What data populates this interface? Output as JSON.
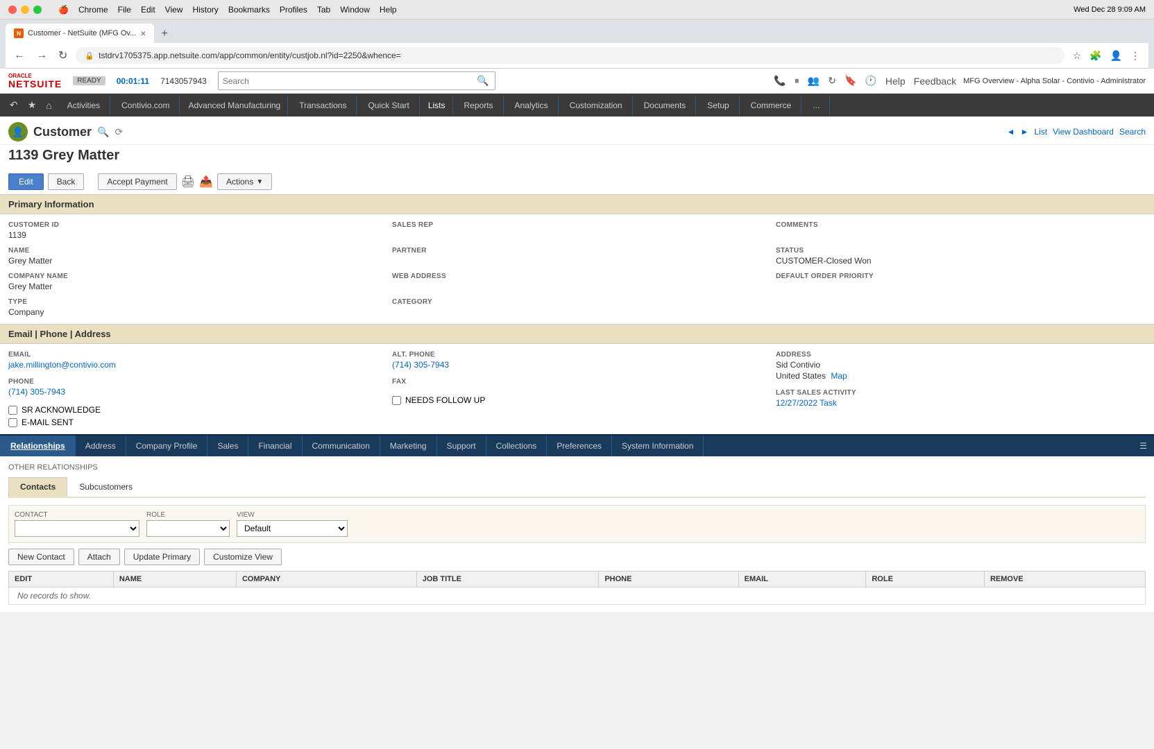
{
  "macbar": {
    "menus": [
      "Chrome",
      "File",
      "Edit",
      "View",
      "History",
      "Bookmarks",
      "Profiles",
      "Tab",
      "Window",
      "Help"
    ],
    "datetime": "Wed Dec 28  9:09 AM"
  },
  "browser": {
    "tab_title": "Customer - NetSuite (MFG Ov...",
    "address": "tstdrv1705375.app.netsuite.com/app/common/entity/custjob.nl?id=2250&whence=",
    "new_tab_label": "+"
  },
  "ns_header": {
    "logo": "ORACLE NETSUITE",
    "ready_label": "READY",
    "timer": "00:01:11",
    "phone": "7143057943",
    "help_label": "Help",
    "feedback_label": "Feedback",
    "account": "MFG Overview - Alpha Solar - Contivio - Administrator"
  },
  "ns_nav": {
    "home_icon": "⌂",
    "star_icon": "★",
    "back_icon": "↶",
    "items": [
      {
        "label": "Activities"
      },
      {
        "label": "Contivio.com"
      },
      {
        "label": "Advanced Manufacturing"
      },
      {
        "label": "Transactions"
      },
      {
        "label": "Quick Start"
      },
      {
        "label": "Lists"
      },
      {
        "label": "Reports"
      },
      {
        "label": "Analytics"
      },
      {
        "label": "Customization"
      },
      {
        "label": "Documents"
      },
      {
        "label": "Setup"
      },
      {
        "label": "Commerce"
      },
      {
        "label": "..."
      }
    ]
  },
  "page": {
    "entity_type": "Customer",
    "record_title": "1139 Grey Matter",
    "nav_prev": "◄",
    "nav_next": "►",
    "list_label": "List",
    "view_dashboard_label": "View Dashboard",
    "search_label": "Search",
    "buttons": {
      "edit": "Edit",
      "back": "Back",
      "accept_payment": "Accept Payment",
      "actions": "Actions"
    }
  },
  "primary_info": {
    "section_title": "Primary Information",
    "customer_id_label": "CUSTOMER ID",
    "customer_id": "1139",
    "name_label": "NAME",
    "name": "Grey Matter",
    "company_name_label": "COMPANY NAME",
    "company_name": "Grey Matter",
    "type_label": "TYPE",
    "type": "Company",
    "sales_rep_label": "SALES REP",
    "sales_rep": "",
    "partner_label": "PARTNER",
    "partner": "",
    "web_address_label": "WEB ADDRESS",
    "web_address": "",
    "category_label": "CATEGORY",
    "category": "",
    "comments_label": "COMMENTS",
    "comments": "",
    "status_label": "STATUS",
    "status": "CUSTOMER-Closed Won",
    "default_order_priority_label": "DEFAULT ORDER PRIORITY",
    "default_order_priority": ""
  },
  "email_phone": {
    "section_title": "Email | Phone | Address",
    "email_label": "EMAIL",
    "email": "jake.millington@contivio.com",
    "alt_phone_label": "ALT. PHONE",
    "alt_phone": "(714) 305-7943",
    "address_label": "ADDRESS",
    "address_line1": "Sid Contivio",
    "address_line2": "United States",
    "map_label": "Map",
    "phone_label": "PHONE",
    "phone": "(714) 305-7943",
    "fax_label": "FAX",
    "fax": "",
    "sr_acknowledge_label": "SR ACKNOWLEDGE",
    "needs_follow_up_label": "NEEDS FOLLOW UP",
    "email_sent_label": "E-MAIL SENT",
    "last_sales_activity_label": "LAST SALES ACTIVITY",
    "last_sales_activity": "12/27/2022 Task"
  },
  "tabs": [
    {
      "label": "Relationships",
      "active": true
    },
    {
      "label": "Address"
    },
    {
      "label": "Company Profile"
    },
    {
      "label": "Sales"
    },
    {
      "label": "Financial"
    },
    {
      "label": "Communication"
    },
    {
      "label": "Marketing"
    },
    {
      "label": "Support"
    },
    {
      "label": "Collections"
    },
    {
      "label": "Preferences"
    },
    {
      "label": "System Information"
    }
  ],
  "relationships": {
    "other_relationships_label": "OTHER RELATIONSHIPS",
    "sub_tabs": [
      {
        "label": "Contacts",
        "active": true
      },
      {
        "label": "Subcustomers"
      }
    ],
    "contact_label": "CONTACT",
    "role_label": "ROLE",
    "view_label": "VIEW",
    "view_default": "Default",
    "buttons": {
      "new_contact": "New Contact",
      "attach": "Attach",
      "update_primary": "Update Primary",
      "customize_view": "Customize View"
    },
    "table_headers": [
      "EDIT",
      "NAME",
      "COMPANY",
      "JOB TITLE",
      "PHONE",
      "EMAIL",
      "ROLE",
      "REMOVE"
    ],
    "no_records": "No records to show."
  }
}
